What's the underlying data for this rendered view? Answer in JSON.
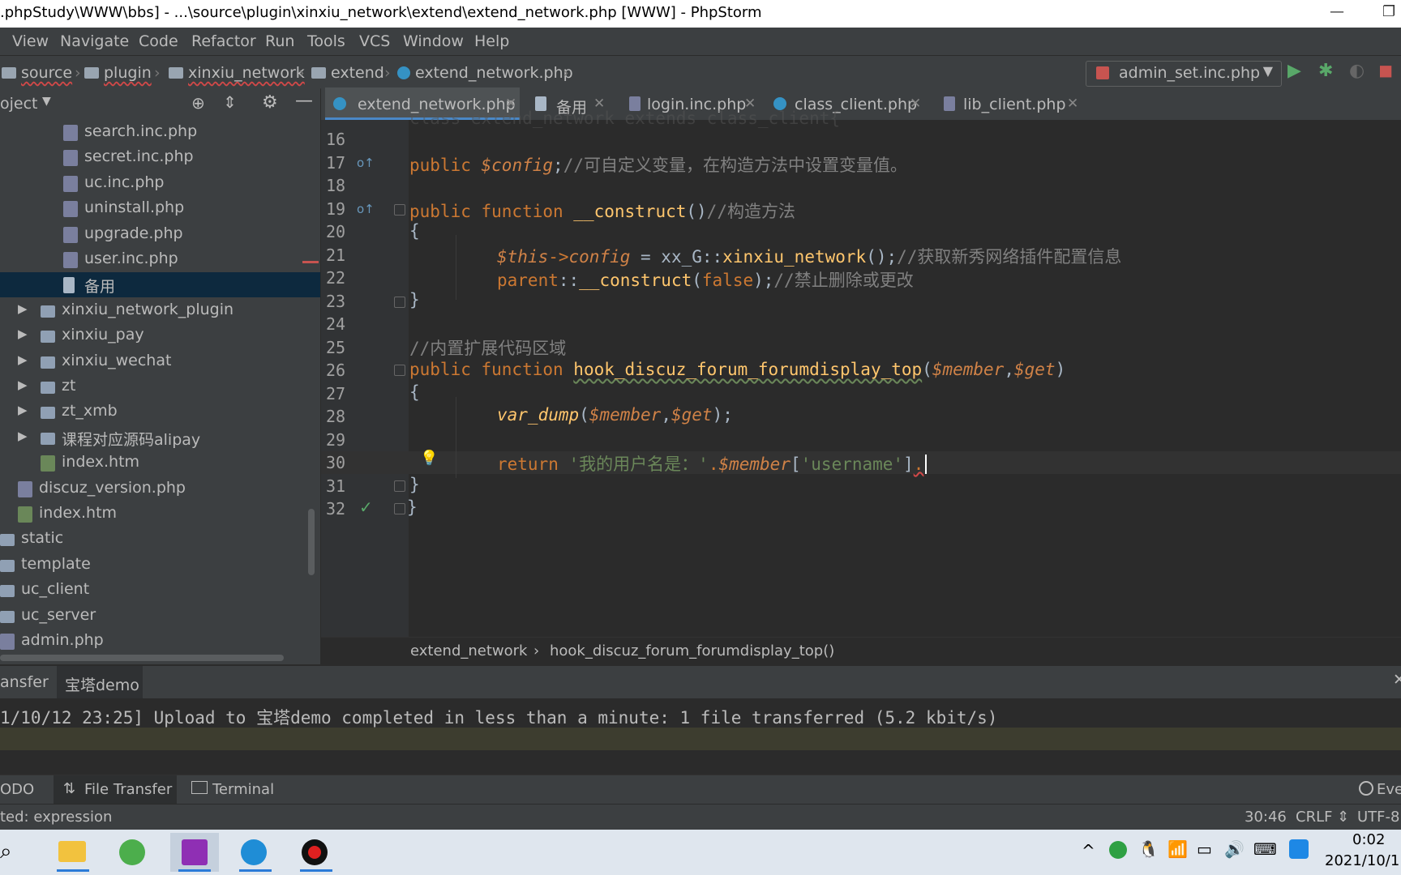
{
  "window": {
    "title": ".phpStudy\\WWW\\bbs] - ...\\source\\plugin\\xinxiu_network\\extend\\extend_network.php [WWW] - PhpStorm",
    "minimize": "—",
    "restore": "❐"
  },
  "menu": [
    "View",
    "Navigate",
    "Code",
    "Refactor",
    "Run",
    "Tools",
    "VCS",
    "Window",
    "Help"
  ],
  "breadcrumb": [
    "source",
    "plugin",
    "xinxiu_network",
    "extend",
    "extend_network.php"
  ],
  "run_config": {
    "label": "admin_set.inc.php",
    "arrow": "▼"
  },
  "project": {
    "header": "oject",
    "tree": [
      {
        "label": "search.inc.php",
        "type": "php",
        "indent": 2
      },
      {
        "label": "secret.inc.php",
        "type": "php",
        "indent": 2
      },
      {
        "label": "uc.inc.php",
        "type": "php",
        "indent": 2
      },
      {
        "label": "uninstall.php",
        "type": "php",
        "indent": 2
      },
      {
        "label": "upgrade.php",
        "type": "php",
        "indent": 2
      },
      {
        "label": "user.inc.php",
        "type": "php",
        "indent": 2
      },
      {
        "label": "备用",
        "type": "txt",
        "indent": 2,
        "selected": true
      },
      {
        "label": "xinxiu_network_plugin",
        "type": "folder",
        "indent": 1,
        "arrow": true
      },
      {
        "label": "xinxiu_pay",
        "type": "folder",
        "indent": 1,
        "arrow": true
      },
      {
        "label": "xinxiu_wechat",
        "type": "folder",
        "indent": 1,
        "arrow": true
      },
      {
        "label": "zt",
        "type": "folder",
        "indent": 1,
        "arrow": true
      },
      {
        "label": "zt_xmb",
        "type": "folder",
        "indent": 1,
        "arrow": true
      },
      {
        "label": "课程对应源码alipay",
        "type": "folder",
        "indent": 1,
        "arrow": true
      },
      {
        "label": "index.htm",
        "type": "html",
        "indent": 1
      },
      {
        "label": "discuz_version.php",
        "type": "php",
        "indent": 0
      },
      {
        "label": "index.htm",
        "type": "html",
        "indent": 0
      },
      {
        "label": "static",
        "type": "folder",
        "indent": -1
      },
      {
        "label": "template",
        "type": "folder",
        "indent": -1
      },
      {
        "label": "uc_client",
        "type": "folder",
        "indent": -1
      },
      {
        "label": "uc_server",
        "type": "folder",
        "indent": -1
      },
      {
        "label": "admin.php",
        "type": "php",
        "indent": -1
      }
    ]
  },
  "tabs": [
    {
      "label": "extend_network.php",
      "icon": "c",
      "active": true
    },
    {
      "label": "备用",
      "icon": "file"
    },
    {
      "label": "login.inc.php",
      "icon": "php"
    },
    {
      "label": "class_client.php",
      "icon": "c"
    },
    {
      "label": "lib_client.php",
      "icon": "php"
    }
  ],
  "code": {
    "line_numbers": [
      "16",
      "17",
      "18",
      "19",
      "20",
      "21",
      "22",
      "23",
      "24",
      "25",
      "26",
      "27",
      "28",
      "29",
      "30",
      "31",
      "32"
    ],
    "line17_kw": "public ",
    "line17_var": "$config",
    "line17_rest": ";",
    "line17_cm": "//可自定义变量，在构造方法中设置变量值。",
    "line19_kw": "public function ",
    "line19_fn": "__construct",
    "line19_rest": "()",
    "line19_cm": "//构造方法",
    "brace_open": "{",
    "brace_close": "}",
    "line21_a": "$this",
    "line21_b": "->",
    "line21_c": "config",
    "line21_d": " = xx_G::",
    "line21_e": "xinxiu_network",
    "line21_f": "();",
    "line21_cm": "//获取新秀网络插件配置信息",
    "line22_kw": "parent",
    "line22_a": "::",
    "line22_fn": "__construct",
    "line22_b": "(",
    "line22_kw2": "false",
    "line22_c": ");",
    "line22_cm": "//禁止删除或更改",
    "line25_cm": "//内置扩展代码区域",
    "line26_kw": "public function ",
    "line26_fn": "hook_discuz_forum_forumdisplay_top",
    "line26_a": "(",
    "line26_v1": "$member",
    "line26_b": ",",
    "line26_v2": "$get",
    "line26_c": ")",
    "line28_fn": "var_dump",
    "line28_a": "(",
    "line28_v1": "$member",
    "line28_b": ",",
    "line28_v2": "$get",
    "line28_c": ");",
    "line30_kw": "return ",
    "line30_str": "'我的用户名是：'",
    "line30_dot": ".",
    "line30_var": "$member",
    "line30_a": "[",
    "line30_str2": "'username'",
    "line30_b": "]",
    "line30_dot2": ".",
    "line32": "}"
  },
  "editor_breadcrumb": {
    "cls": "extend_network",
    "sep": "›",
    "method": "hook_discuz_forum_forumdisplay_top()"
  },
  "bottom_tabs": [
    "ansfer",
    "宝塔demo"
  ],
  "console_line": "1/10/12 23:25] Upload to 宝塔demo completed in less than a minute: 1 file transferred (5.2 kbit/s)",
  "tool_tabs": [
    "ODO",
    "File Transfer",
    "Terminal"
  ],
  "event_log": "Eve",
  "status": {
    "left": "ted: expression",
    "pos": "30:46",
    "crlf": "CRLF ⇕",
    "enc": "UTF-8"
  },
  "taskbar": {
    "time": "0:02",
    "date": "2021/10/1"
  }
}
